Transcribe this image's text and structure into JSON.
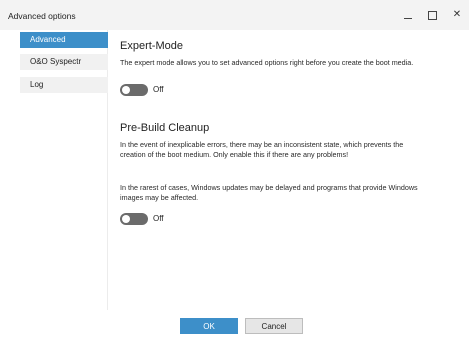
{
  "window": {
    "title": "Advanced options"
  },
  "sidebar": {
    "items": [
      {
        "label": "Advanced",
        "active": true
      },
      {
        "label": "O&O Syspectr",
        "active": false
      },
      {
        "label": "Log",
        "active": false
      }
    ]
  },
  "sections": [
    {
      "title": "Expert-Mode",
      "description": "The expert mode allows you to set advanced options right before you create the boot media.",
      "toggle_label": "Off"
    },
    {
      "title": "Pre-Build Cleanup",
      "description": "In the event of inexplicable errors, there may be an inconsistent state, which prevents the creation of the boot medium. Only enable this if there are any problems!",
      "note": "In the rarest of cases, Windows updates may be delayed and programs that provide Windows images may be affected.",
      "toggle_label": "Off"
    }
  ],
  "footer": {
    "ok_label": "OK",
    "cancel_label": "Cancel"
  },
  "colors": {
    "accent": "#3d8fc9",
    "toggle_off": "#6b6b6b",
    "sidebar_item_bg": "#f1f1f1"
  },
  "icons": {
    "minimize": "minimize-icon",
    "maximize": "maximize-icon",
    "close": "close-icon"
  }
}
